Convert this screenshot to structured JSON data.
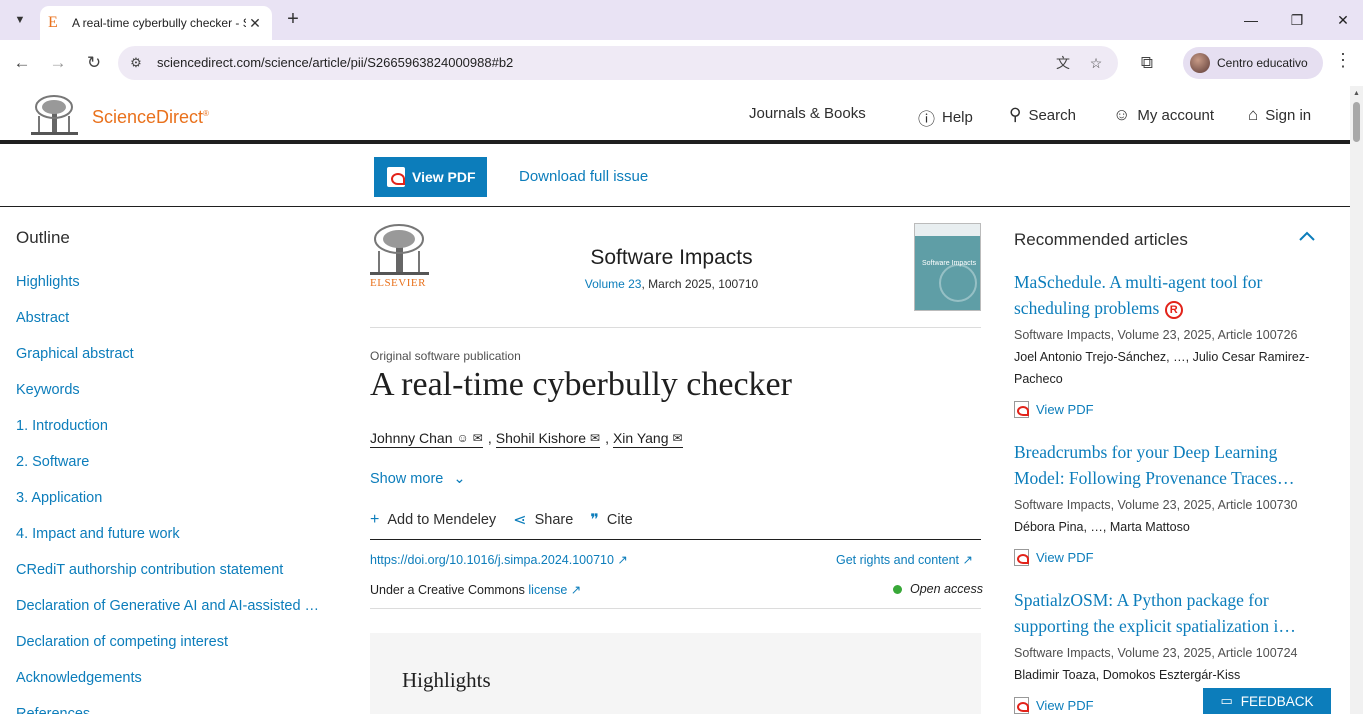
{
  "browser": {
    "tab_favicon": "E",
    "tab_title": "A real-time cyberbully checker - ScienceDirect",
    "url": "sciencedirect.com/science/article/pii/S2665963824000988#b2",
    "profile_label": "Centro educativo"
  },
  "site": {
    "brand": "ScienceDirect",
    "brand_mark": "®",
    "nav": {
      "journals": "Journals & Books",
      "help": "Help",
      "search": "Search",
      "account": "My account",
      "signin": "Sign in"
    }
  },
  "toolbar": {
    "view_pdf": "View PDF",
    "download_issue": "Download full issue"
  },
  "outline": {
    "title": "Outline",
    "items": [
      "Highlights",
      "Abstract",
      "Graphical abstract",
      "Keywords",
      "1. Introduction",
      "2. Software",
      "3. Application",
      "4. Impact and future work",
      "CRediT authorship contribution statement",
      "Declaration of Generative AI and AI-assisted …",
      "Declaration of competing interest",
      "Acknowledgements",
      "References"
    ]
  },
  "article": {
    "publisher": "ELSEVIER",
    "journal": "Software Impacts",
    "volume_link": "Volume 23",
    "issue_info": ", March 2025, 100710",
    "cover_text": "Software Impacts",
    "type": "Original software publication",
    "title": "A real-time cyberbully checker",
    "authors": [
      "Johnny Chan",
      "Shohil Kishore",
      "Xin Yang"
    ],
    "show_more": "Show more",
    "actions": {
      "mendeley": "Add to Mendeley",
      "share": "Share",
      "cite": "Cite"
    },
    "doi": "https://doi.org/10.1016/j.simpa.2024.100710 ↗",
    "rights": "Get rights and content ↗",
    "license_prefix": "Under a Creative Commons ",
    "license_link": "license ↗",
    "open_access": "Open access",
    "highlights_heading": "Highlights"
  },
  "recommended": {
    "title": "Recommended articles",
    "items": [
      {
        "title": "MaSchedule. A multi-agent tool for scheduling problems",
        "meta": "Software Impacts, Volume 23, 2025, Article 100726",
        "authors": "Joel Antonio Trejo-Sánchez, …, Julio Cesar Ramirez-Pacheco",
        "pdf": "View PDF"
      },
      {
        "title": "Breadcrumbs for your Deep Learning Model: Following Provenance Traces…",
        "meta": "Software Impacts, Volume 23, 2025, Article 100730",
        "authors": "Débora Pina, …, Marta Mattoso",
        "pdf": "View PDF"
      },
      {
        "title": "SpatialzOSM: A Python package for supporting the explicit spatialization i…",
        "meta": "Software Impacts, Volume 23, 2025, Article 100724",
        "authors": "Bladimir Toaza, Domokos Esztergár-Kiss",
        "pdf": "View PDF"
      }
    ]
  },
  "feedback_label": "FEEDBACK",
  "colors": {
    "link": "#0c7dbb",
    "brand_orange": "#e9711c",
    "open_access_green": "#38a838"
  }
}
